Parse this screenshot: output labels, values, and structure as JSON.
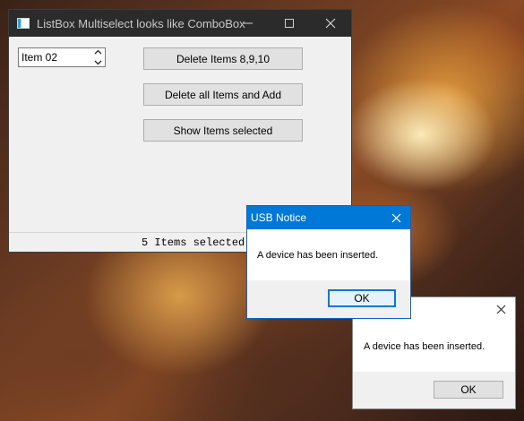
{
  "main_window": {
    "title": "ListBox Multiselect looks like ComboBox",
    "caption": {
      "minimize": "—",
      "maximize": "☐",
      "close": "✕"
    },
    "spinner_value": "Item 02",
    "buttons": {
      "delete_items": "Delete Items 8,9,10",
      "delete_all": "Delete all Items and Add",
      "show_selected": "Show Items selected"
    },
    "status_text": "5 Items selected"
  },
  "usb_notice": {
    "title": "USB Notice",
    "message": "A device has been inserted.",
    "ok_label": "OK"
  },
  "second_notice": {
    "message": "A device has been inserted.",
    "ok_label": "OK"
  }
}
